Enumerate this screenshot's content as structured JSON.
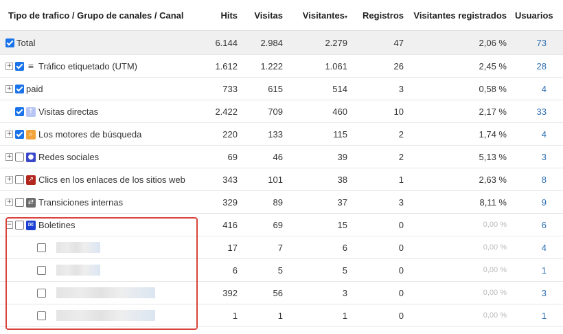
{
  "columns": {
    "name": "Tipo de trafico / Grupo de canales / Canal",
    "hits": "Hits",
    "visits": "Visitas",
    "visitors": "Visitantes",
    "visitors_sort": "▾",
    "registrations": "Registros",
    "registered_visitors": "Visitantes registrados",
    "users": "Usuarios"
  },
  "rows": [
    {
      "label": "Total",
      "checked": true,
      "expander": "",
      "icon": "",
      "icon_name": "",
      "hits": "6.144",
      "visits": "2.984",
      "visitors": "2.279",
      "registrations": "47",
      "reg_visitors": "2,06 %",
      "users": "73"
    },
    {
      "label": "Tráfico etiquetado (UTM)",
      "checked": true,
      "expander": "+",
      "icon": "≡",
      "icon_name": "list-icon",
      "hits": "1.612",
      "visits": "1.222",
      "visitors": "1.061",
      "registrations": "26",
      "reg_visitors": "2,45 %",
      "users": "28"
    },
    {
      "label": "paid",
      "checked": true,
      "expander": "+",
      "icon": "",
      "icon_name": "",
      "hits": "733",
      "visits": "615",
      "visitors": "514",
      "registrations": "3",
      "reg_visitors": "0,58 %",
      "users": "4"
    },
    {
      "label": "Visitas directas",
      "checked": true,
      "expander": "",
      "icon": "↑",
      "icon_name": "arrow-up-icon",
      "hits": "2.422",
      "visits": "709",
      "visitors": "460",
      "registrations": "10",
      "reg_visitors": "2,17 %",
      "users": "33"
    },
    {
      "label": "Los motores de búsqueda",
      "checked": true,
      "expander": "+",
      "icon": "⌕",
      "icon_name": "search-icon",
      "hits": "220",
      "visits": "133",
      "visitors": "115",
      "registrations": "2",
      "reg_visitors": "1,74 %",
      "users": "4"
    },
    {
      "label": "Redes sociales",
      "checked": false,
      "expander": "+",
      "icon": "●",
      "icon_name": "social-icon",
      "hits": "69",
      "visits": "46",
      "visitors": "39",
      "registrations": "2",
      "reg_visitors": "5,13 %",
      "users": "3"
    },
    {
      "label": "Clics en los enlaces de los sitios web",
      "checked": false,
      "expander": "+",
      "icon": "↗",
      "icon_name": "external-link-icon",
      "hits": "343",
      "visits": "101",
      "visitors": "38",
      "registrations": "1",
      "reg_visitors": "2,63 %",
      "users": "8"
    },
    {
      "label": "Transiciones internas",
      "checked": false,
      "expander": "+",
      "icon": "⇄",
      "icon_name": "transitions-icon",
      "hits": "329",
      "visits": "89",
      "visitors": "37",
      "registrations": "3",
      "reg_visitors": "8,11 %",
      "users": "9"
    },
    {
      "label": "Boletines",
      "checked": false,
      "expander": "−",
      "icon": "✉",
      "icon_name": "mail-icon",
      "hits": "416",
      "visits": "69",
      "visitors": "15",
      "registrations": "0",
      "reg_visitors": "0,00 %",
      "users": "6"
    }
  ],
  "sub_rows": [
    {
      "checked": false,
      "hits": "17",
      "visits": "7",
      "visitors": "6",
      "registrations": "0",
      "reg_visitors": "0,00 %",
      "users": "4"
    },
    {
      "checked": false,
      "hits": "6",
      "visits": "5",
      "visitors": "5",
      "registrations": "0",
      "reg_visitors": "0,00 %",
      "users": "1"
    },
    {
      "checked": false,
      "hits": "392",
      "visits": "56",
      "visitors": "3",
      "registrations": "0",
      "reg_visitors": "0,00 %",
      "users": "3"
    },
    {
      "checked": false,
      "hits": "1",
      "visits": "1",
      "visitors": "1",
      "registrations": "0",
      "reg_visitors": "0,00 %",
      "users": "1"
    }
  ]
}
